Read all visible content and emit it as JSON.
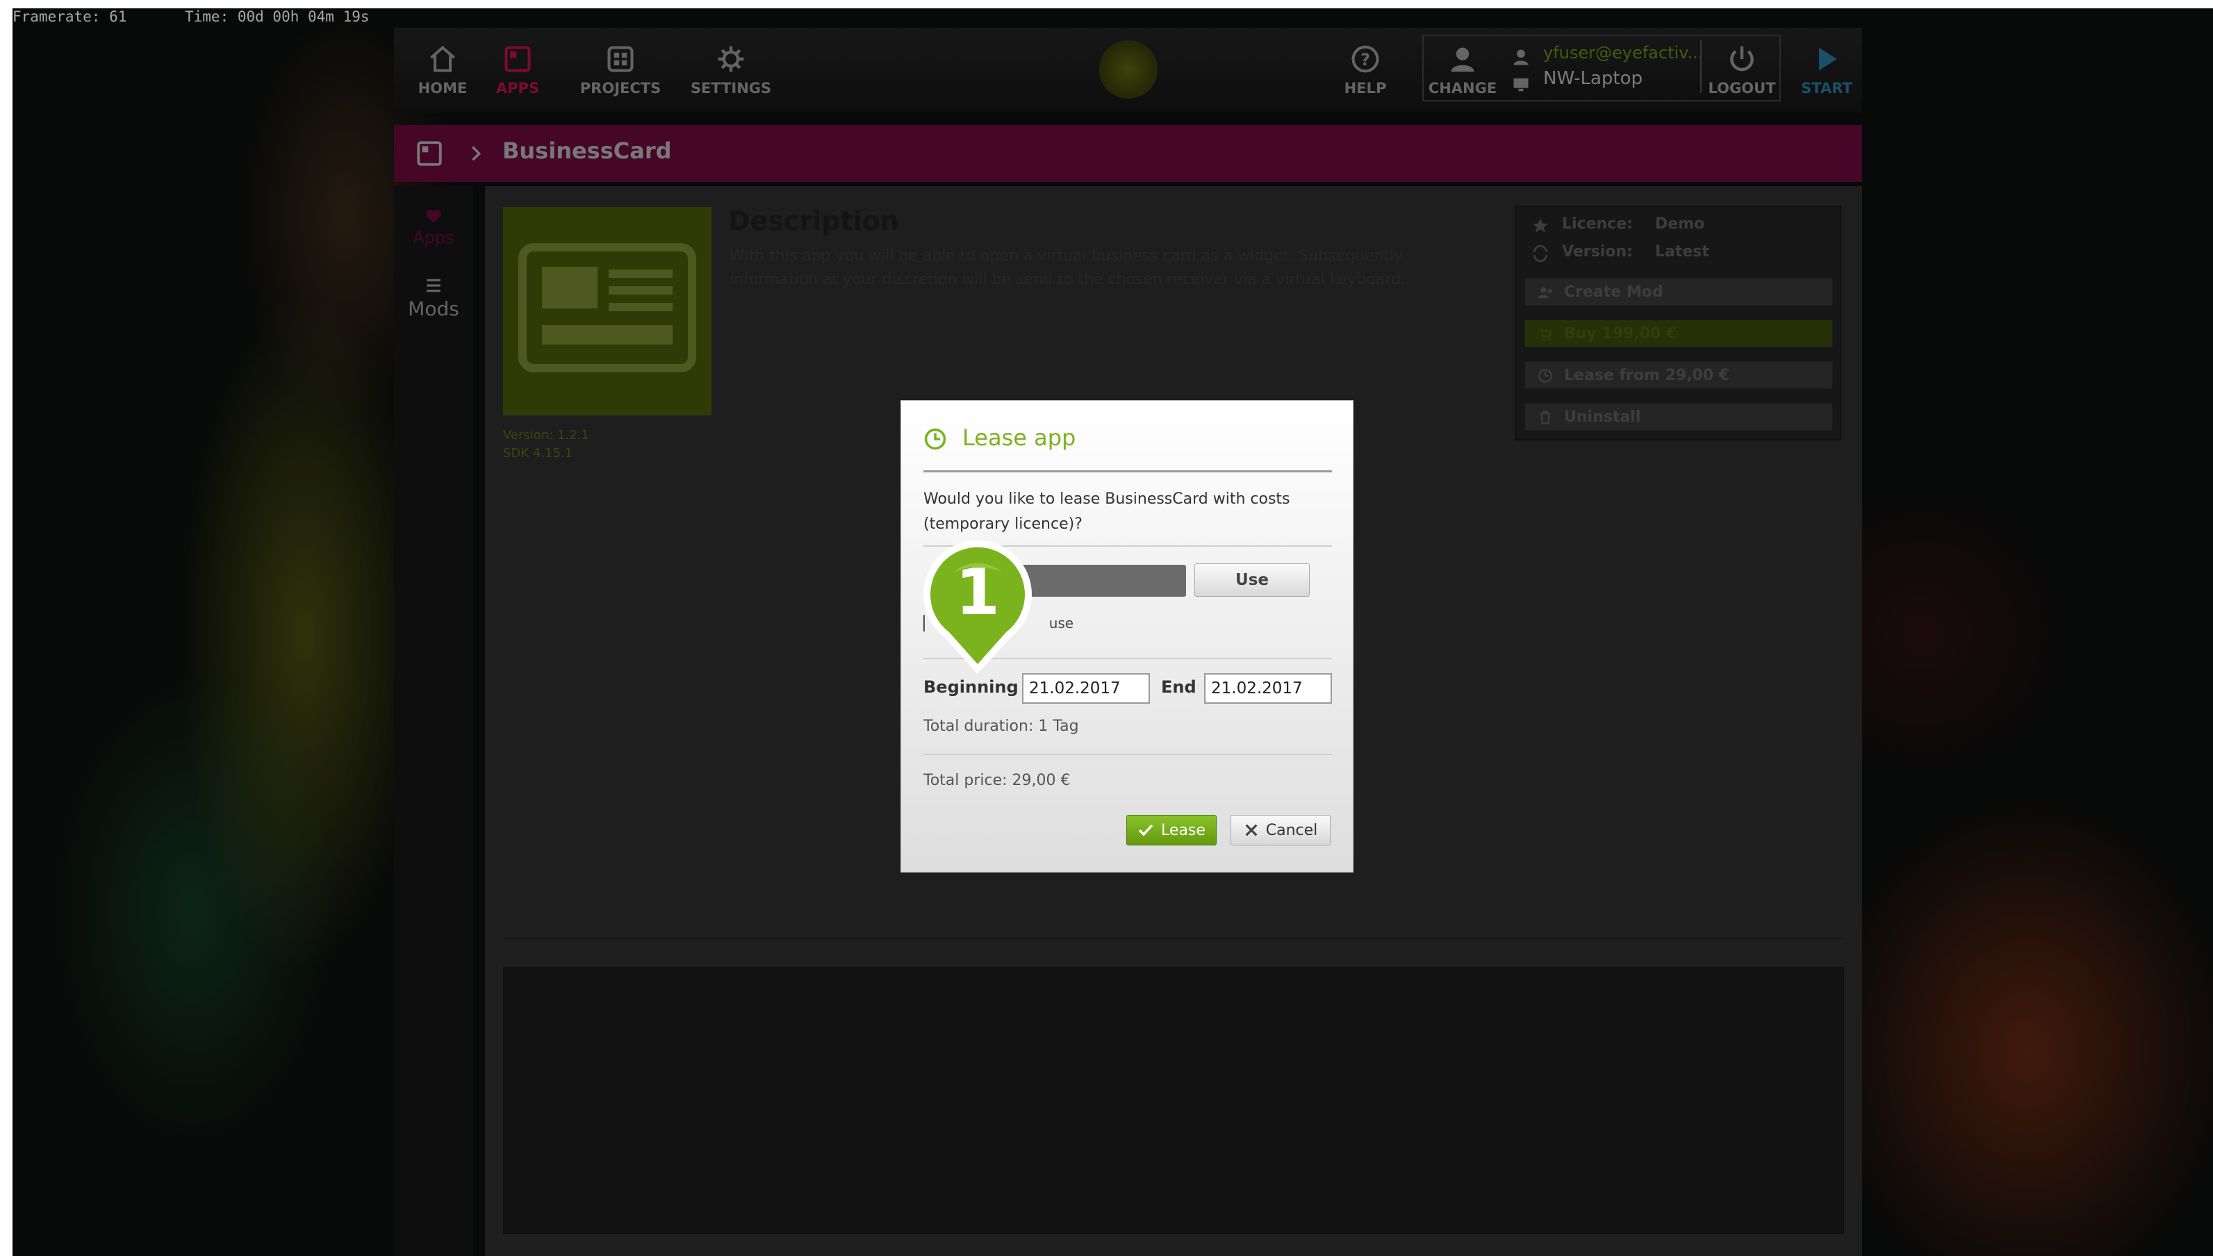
{
  "overlay": {
    "framerate": "Framerate: 61",
    "time": "Time: 00d 00h 04m 19s"
  },
  "nav": {
    "home": "HOME",
    "apps": "APPS",
    "projects": "PROJECTS",
    "settings": "SETTINGS",
    "help": "HELP",
    "change": "CHANGE",
    "user_email": "yfuser@eyefactiv...",
    "device": "NW-Laptop",
    "logout": "LOGOUT",
    "start": "START"
  },
  "breadcrumb": {
    "title": "BusinessCard"
  },
  "rail": {
    "apps": "Apps",
    "mods": "Mods"
  },
  "app": {
    "version": "Version: 1.2.1",
    "sdk": "SDK 4.15.1",
    "description_title": "Description",
    "description_body": "With this app you will be able to open a virtual business card as a widget. Subsequently information at your discretion will be send to the chosen receiver via a virtual keyboard.",
    "licence_label": "Licence:",
    "licence_value": "Demo",
    "version_label": "Version:",
    "version_value": "Latest",
    "create_mod": "Create Mod",
    "buy": "Buy 199,00 €",
    "lease_from": "Lease from 29,00 €",
    "uninstall": "Uninstall"
  },
  "dialog": {
    "title": "Lease app",
    "question": "Would you like to lease BusinessCard with costs (temporary licence)?",
    "use_button": "Use",
    "hint": "use",
    "beginning_label": "Beginning",
    "beginning_value": "21.02.2017",
    "end_label": "End",
    "end_value": "21.02.2017",
    "duration": "Total duration: 1 Tag",
    "price": "Total price: 29,00 €",
    "lease_button": "Lease",
    "cancel_button": "Cancel"
  },
  "marker": {
    "number": "1",
    "color": "#7bb31e"
  },
  "colors": {
    "accent_green": "#7bb31e",
    "brand_magenta": "#c0104f",
    "start_blue": "#2a7aa0"
  }
}
